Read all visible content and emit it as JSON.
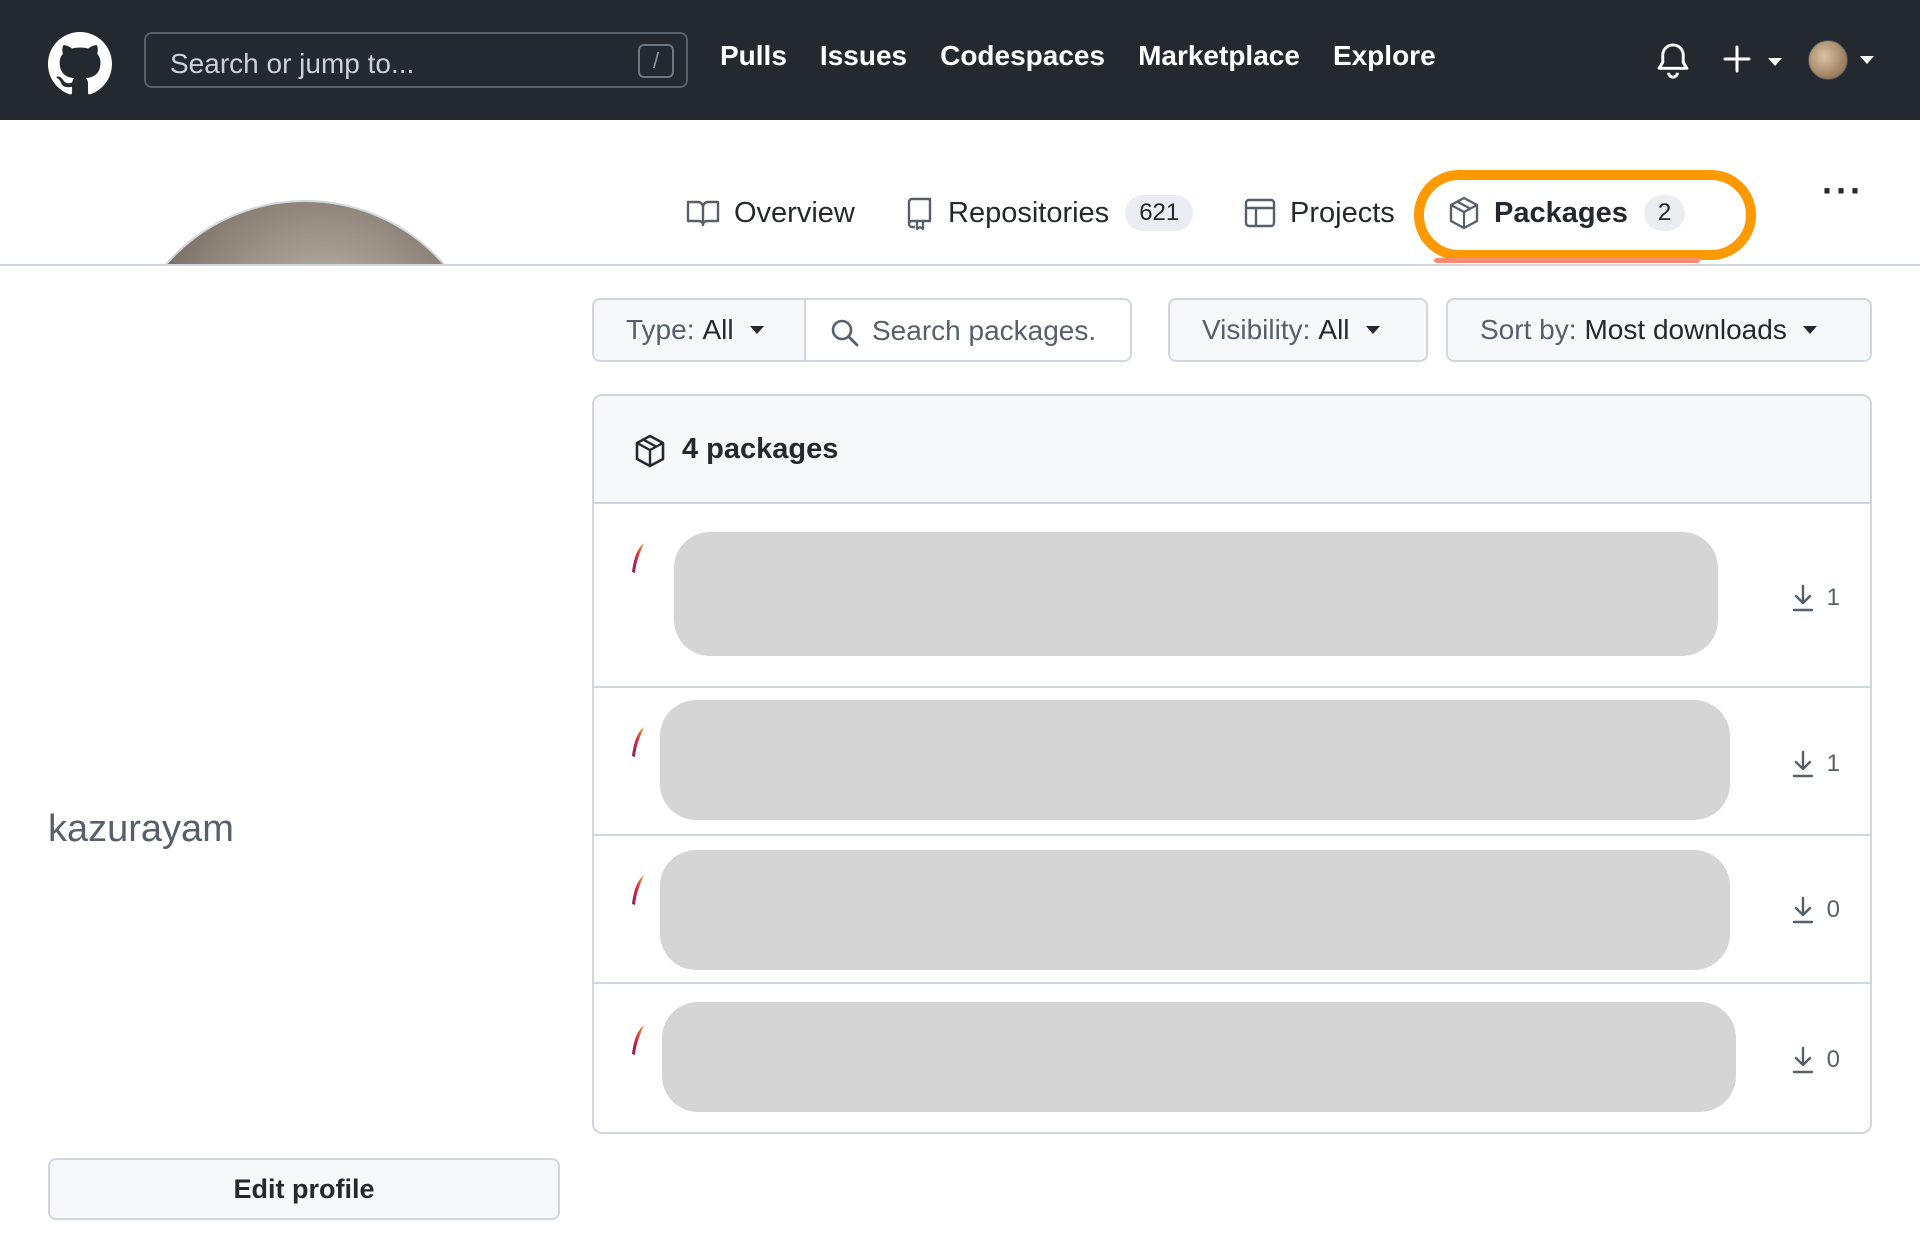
{
  "header": {
    "search_placeholder": "Search or jump to...",
    "search_shortcut": "/",
    "nav": [
      "Pulls",
      "Issues",
      "Codespaces",
      "Marketplace",
      "Explore"
    ]
  },
  "profile_nav": {
    "overview": "Overview",
    "repositories": "Repositories",
    "repositories_count": "621",
    "projects": "Projects",
    "packages": "Packages",
    "packages_count": "2",
    "more": "···"
  },
  "profile": {
    "username": "kazurayam",
    "edit_profile": "Edit profile"
  },
  "filters": {
    "type_label": "Type:",
    "type_value": "All",
    "search_placeholder": "Search packages.",
    "visibility_label": "Visibility:",
    "visibility_value": "All",
    "sort_label": "Sort by:",
    "sort_value": "Most downloads"
  },
  "packages": {
    "count_label": "4 packages",
    "items": [
      {
        "downloads": "1"
      },
      {
        "downloads": "1"
      },
      {
        "downloads": "0"
      },
      {
        "downloads": "0"
      }
    ]
  },
  "colors": {
    "header_bg": "#24292f",
    "highlight": "#ff9900",
    "active_underline": "#fd8c73"
  }
}
